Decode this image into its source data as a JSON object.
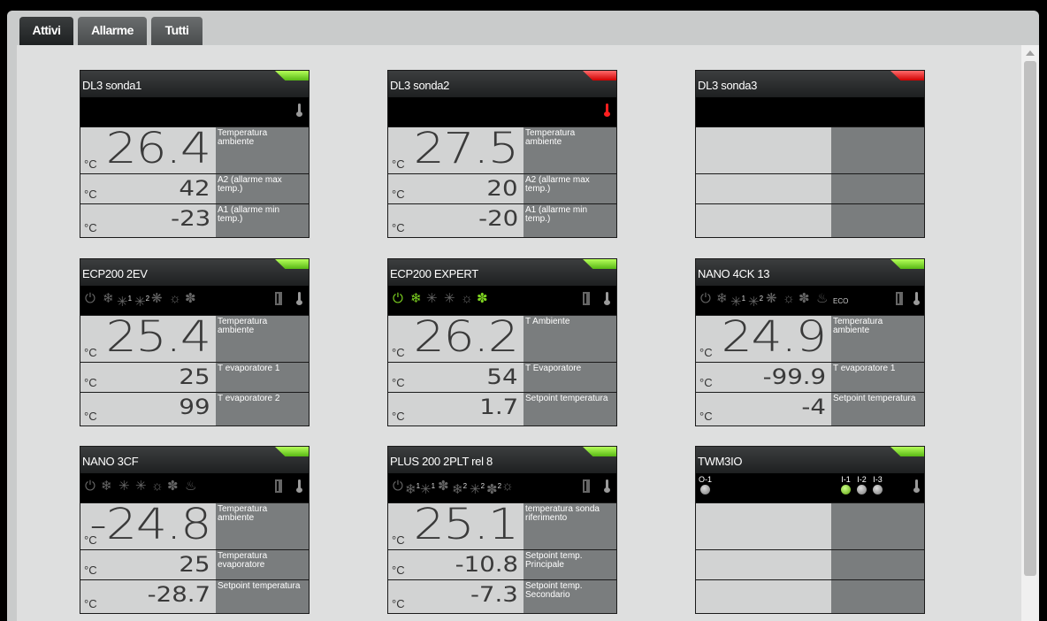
{
  "tabs": [
    {
      "label": "Attivi",
      "active": true
    },
    {
      "label": "Allarme",
      "active": false
    },
    {
      "label": "Tutti",
      "active": false
    }
  ],
  "colors": {
    "ok": "#7ed321",
    "alarm": "#ff1f1f",
    "icon_off": "#666666",
    "icon_on": "#7ed321"
  },
  "cards": [
    {
      "title": "DL3 sonda1",
      "status": "ok",
      "rows": [
        {
          "unit": "°C",
          "value": "26.4",
          "label": "Temperatura ambiente"
        },
        {
          "unit": "°C",
          "value": "42",
          "label": "A2 (allarme max temp.)"
        },
        {
          "unit": "°C",
          "value": "-23",
          "label": "A1 (allarme min temp.)"
        }
      ]
    },
    {
      "title": "DL3 sonda2",
      "status": "alarm",
      "rows": [
        {
          "unit": "°C",
          "value": "27.5",
          "label": "Temperatura ambiente"
        },
        {
          "unit": "°C",
          "value": "20",
          "label": "A2 (allarme max temp.)"
        },
        {
          "unit": "°C",
          "value": "-20",
          "label": "A1 (allarme min temp.)"
        }
      ]
    },
    {
      "title": "DL3 sonda3",
      "status": "alarm",
      "rows": [
        {
          "unit": "",
          "value": "",
          "label": ""
        },
        {
          "unit": "",
          "value": "",
          "label": ""
        },
        {
          "unit": "",
          "value": "",
          "label": ""
        }
      ]
    },
    {
      "title": "ECP200 2EV",
      "status": "ok",
      "rows": [
        {
          "unit": "°C",
          "value": "25.4",
          "label": "Temperatura ambiente"
        },
        {
          "unit": "°C",
          "value": "25",
          "label": "T evaporatore 1"
        },
        {
          "unit": "°C",
          "value": "99",
          "label": "T evaporatore 2"
        }
      ]
    },
    {
      "title": "ECP200 EXPERT",
      "status": "ok",
      "rows": [
        {
          "unit": "°C",
          "value": "26.2",
          "label": "T Ambiente"
        },
        {
          "unit": "°C",
          "value": "54",
          "label": "T Evaporatore"
        },
        {
          "unit": "°C",
          "value": "1.7",
          "label": "Setpoint temperatura"
        }
      ]
    },
    {
      "title": "NANO 4CK 13",
      "status": "ok",
      "eco": "ECO",
      "rows": [
        {
          "unit": "°C",
          "value": "24.9",
          "label": "Temperatura ambiente"
        },
        {
          "unit": "°C",
          "value": "-99.9",
          "label": "T evaporatore 1"
        },
        {
          "unit": "°C",
          "value": "-4",
          "label": "Setpoint temperatura"
        }
      ]
    },
    {
      "title": "NANO 3CF",
      "status": "ok",
      "rows": [
        {
          "unit": "°C",
          "value": "-24.8",
          "label": "Temperatura ambiente"
        },
        {
          "unit": "°C",
          "value": "25",
          "label": "Temperatura evaporatore"
        },
        {
          "unit": "°C",
          "value": "-28.7",
          "label": "Setpoint temperatura"
        }
      ]
    },
    {
      "title": "PLUS 200 2PLT rel 8",
      "status": "ok",
      "rows": [
        {
          "unit": "°C",
          "value": "25.1",
          "label": "temperatura sonda riferimento"
        },
        {
          "unit": "°C",
          "value": "-10.8",
          "label": "Setpoint temp. Principale"
        },
        {
          "unit": "°C",
          "value": "-7.3",
          "label": "Setpoint temp. Secondario"
        }
      ]
    },
    {
      "title": "TWM3IO",
      "status": "ok",
      "io": [
        {
          "label": "O-1",
          "on": false
        },
        {
          "label": "I-1",
          "on": true
        },
        {
          "label": "I-2",
          "on": false
        },
        {
          "label": "I-3",
          "on": false
        }
      ],
      "rows": [
        {
          "unit": "",
          "value": "",
          "label": ""
        },
        {
          "unit": "",
          "value": "",
          "label": ""
        },
        {
          "unit": "",
          "value": "",
          "label": ""
        }
      ]
    }
  ]
}
